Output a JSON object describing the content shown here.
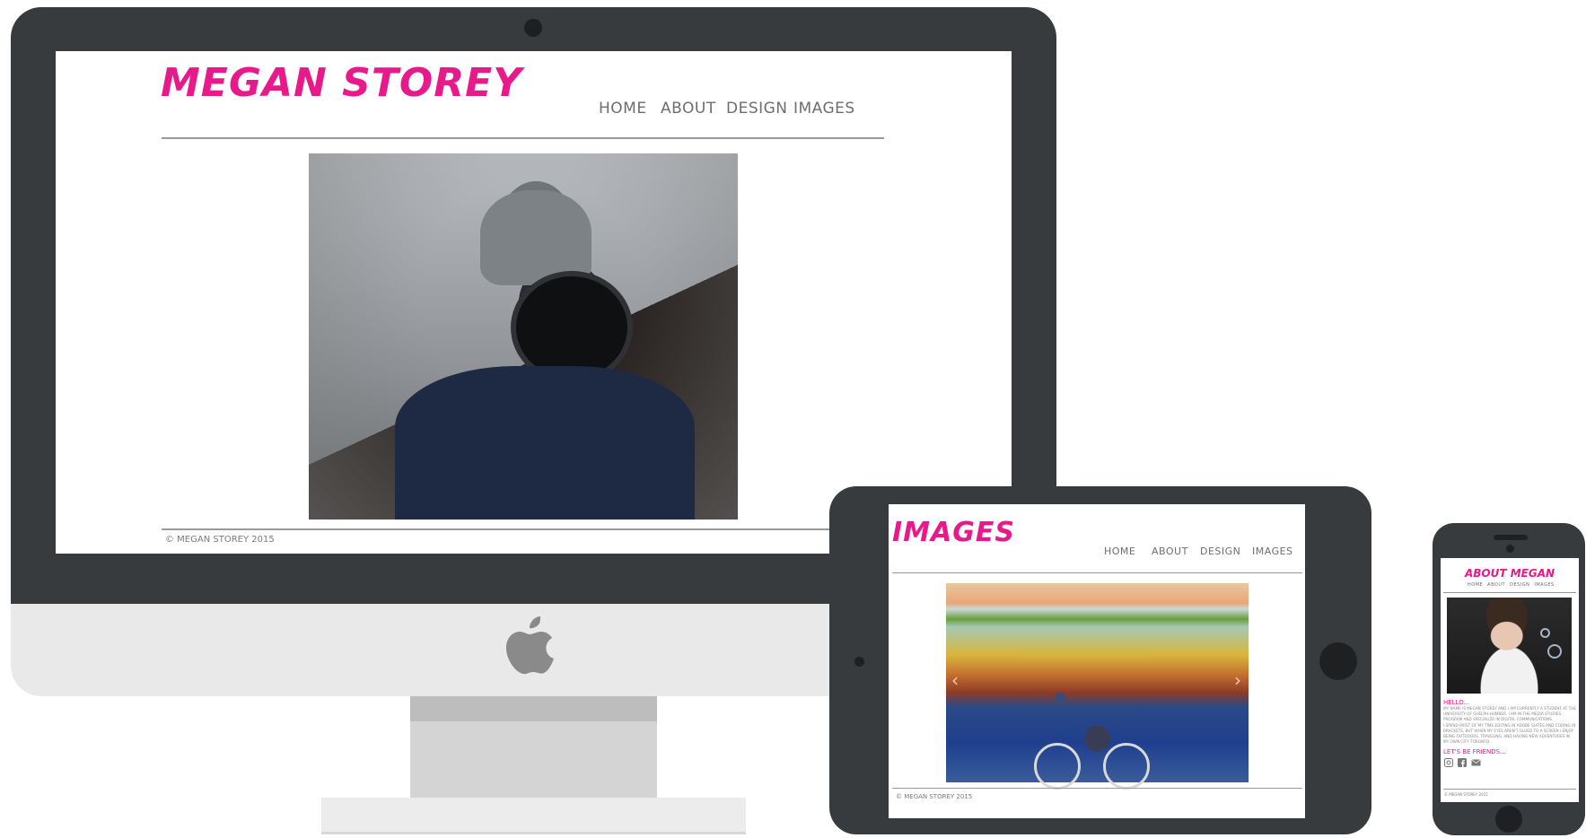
{
  "desktop": {
    "brand": "MEGAN STOREY",
    "nav": [
      "HOME",
      "ABOUT",
      "DESIGN",
      "IMAGES"
    ],
    "footer": "© MEGAN STOREY 2015"
  },
  "tablet": {
    "page_title": "IMAGES",
    "nav": [
      "HOME",
      "ABOUT",
      "DESIGN",
      "IMAGES"
    ],
    "slider_prev": "‹",
    "slider_next": "›",
    "footer": "© MEGAN STOREY 2015"
  },
  "phone": {
    "page_title": "ABOUT MEGAN",
    "nav": [
      "HOME",
      "ABOUT",
      "DESIGN",
      "IMAGES"
    ],
    "hello_heading": "HELLO...",
    "bio_1": "MY NAME IS MEGAN STOREY AND I AM CURRENTLY A STUDENT AT THE UNIVERSITY OF GUELPH-HUMBER. I AM IN THE MEDIA STUDIES PROGRAM AND SPECIALIZE IN DIGITAL COMMUNICATIONS.",
    "bio_2": "I SPEND MOST OF MY TIME EDITING IN ADOBE SUITES AND CODING IN BRACKETS, BUT WHEN MY EYES AREN'T GLUED TO A SCREEN I ENJOY BEING OUTDOORS, TRAVELING, AND HAVING NEW ADVENTURES IN MY OWN CITY TORONTO.",
    "friends_heading": "LET'S BE FRIENDS...",
    "footer": "© MEGAN STOREY 2015",
    "social_icons": [
      "instagram-icon",
      "facebook-icon",
      "email-icon"
    ]
  },
  "colors": {
    "brand_pink": "#e8198b",
    "device_dark": "#383b3e",
    "nav_gray": "#6e6e6e"
  }
}
